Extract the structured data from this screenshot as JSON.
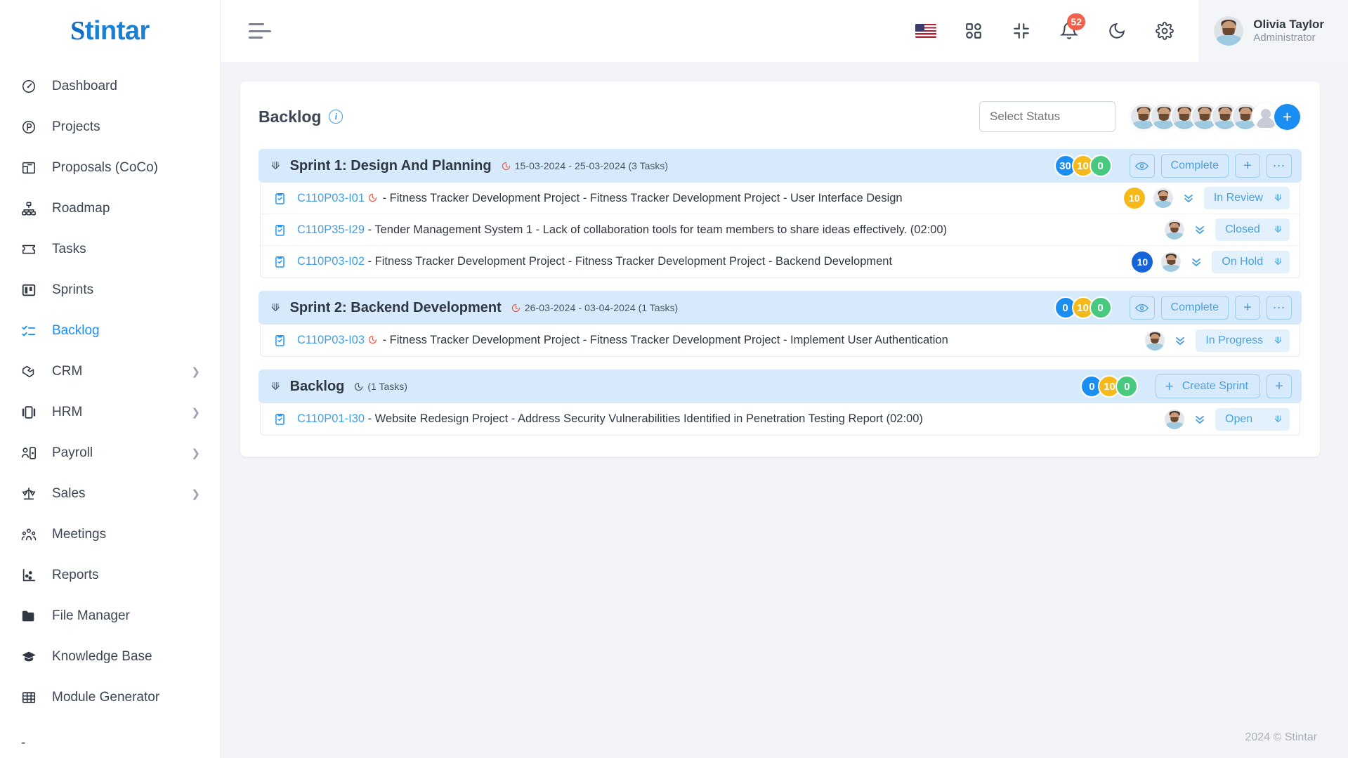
{
  "brand": {
    "logo_text": "Stintar",
    "logo_mark": "S"
  },
  "sidebar": {
    "items": [
      {
        "label": "Dashboard",
        "icon": "gauge-icon",
        "active": false,
        "has_chevron": false
      },
      {
        "label": "Projects",
        "icon": "projects-circle-p-icon",
        "active": false,
        "has_chevron": false
      },
      {
        "label": "Proposals (CoCo)",
        "icon": "proposals-icon",
        "active": false,
        "has_chevron": false
      },
      {
        "label": "Roadmap",
        "icon": "roadmap-hierarchy-icon",
        "active": false,
        "has_chevron": false
      },
      {
        "label": "Tasks",
        "icon": "ticket-icon",
        "active": false,
        "has_chevron": false
      },
      {
        "label": "Sprints",
        "icon": "board-icon",
        "active": false,
        "has_chevron": false
      },
      {
        "label": "Backlog",
        "icon": "checklist-icon",
        "active": true,
        "has_chevron": false
      },
      {
        "label": "CRM",
        "icon": "handshake-icon",
        "active": false,
        "has_chevron": true
      },
      {
        "label": "HRM",
        "icon": "hrm-icon",
        "active": false,
        "has_chevron": true
      },
      {
        "label": "Payroll",
        "icon": "payroll-person-icon",
        "active": false,
        "has_chevron": true
      },
      {
        "label": "Sales",
        "icon": "scales-icon",
        "active": false,
        "has_chevron": true
      },
      {
        "label": "Meetings",
        "icon": "people-group-icon",
        "active": false,
        "has_chevron": false
      },
      {
        "label": "Reports",
        "icon": "reports-chart-icon",
        "active": false,
        "has_chevron": false
      },
      {
        "label": "File Manager",
        "icon": "folder-icon",
        "active": false,
        "has_chevron": false
      },
      {
        "label": "Knowledge Base",
        "icon": "graduation-cap-icon",
        "active": false,
        "has_chevron": false
      },
      {
        "label": "Module Generator",
        "icon": "grid-table-icon",
        "active": false,
        "has_chevron": false
      }
    ],
    "trailing_mark": "-"
  },
  "topbar": {
    "menu_toggle": "hamburger-icon",
    "language_flag": "us-flag-icon",
    "apps_icon": "apps-grid-icon",
    "fullscreen_icon": "collapse-screen-icon",
    "notifications_icon": "bell-icon",
    "notifications_count": "52",
    "theme_icon": "moon-icon",
    "settings_icon": "gear-icon",
    "user": {
      "name": "Olivia Taylor",
      "role": "Administrator"
    }
  },
  "panel": {
    "title": "Backlog",
    "info_tooltip_icon": "info-icon",
    "status_filter_placeholder": "Select Status",
    "member_avatar_count": 6,
    "add_member_label": "+"
  },
  "groups": [
    {
      "name": "Sprint 1: Design And Planning",
      "dates": "15-03-2024 - 25-03-2024",
      "task_count_label": "(3 Tasks)",
      "clock_color": "#f05a4f",
      "pills": [
        {
          "value": "30",
          "color": "blue"
        },
        {
          "value": "10",
          "color": "amber"
        },
        {
          "value": "0",
          "color": "green"
        }
      ],
      "buttons": [
        {
          "label": "",
          "icon": "eye-icon",
          "name": "preview-sprint-button"
        },
        {
          "label": "Complete",
          "icon": "",
          "name": "complete-sprint-button"
        },
        {
          "label": "",
          "icon": "plus-icon",
          "name": "add-task-button"
        },
        {
          "label": "",
          "icon": "ellipsis-icon",
          "name": "sprint-more-button"
        }
      ],
      "tasks": [
        {
          "key": "C110P03-I01",
          "has_clock": true,
          "text": " - Fitness Tracker Development Project - Fitness Tracker Development Project - User Interface Design",
          "estimate": "10",
          "estimate_color": "amber",
          "status": "In Review"
        },
        {
          "key": "C110P35-I29",
          "has_clock": false,
          "text": " - Tender Management System 1 - Lack of collaboration tools for team members to share ideas effectively. (02:00)",
          "estimate": "",
          "estimate_color": "",
          "status": "Closed"
        },
        {
          "key": "C110P03-I02",
          "has_clock": false,
          "text": " - Fitness Tracker Development Project - Fitness Tracker Development Project - Backend Development",
          "estimate": "10",
          "estimate_color": "blue",
          "status": "On Hold"
        }
      ]
    },
    {
      "name": "Sprint 2: Backend Development",
      "dates": "26-03-2024 - 03-04-2024",
      "task_count_label": "(1 Tasks)",
      "clock_color": "#f05a4f",
      "pills": [
        {
          "value": "0",
          "color": "blue"
        },
        {
          "value": "10",
          "color": "amber"
        },
        {
          "value": "0",
          "color": "green"
        }
      ],
      "buttons": [
        {
          "label": "",
          "icon": "eye-icon",
          "name": "preview-sprint-button"
        },
        {
          "label": "Complete",
          "icon": "",
          "name": "complete-sprint-button"
        },
        {
          "label": "",
          "icon": "plus-icon",
          "name": "add-task-button"
        },
        {
          "label": "",
          "icon": "ellipsis-icon",
          "name": "sprint-more-button"
        }
      ],
      "tasks": [
        {
          "key": "C110P03-I03",
          "has_clock": true,
          "text": " - Fitness Tracker Development Project - Fitness Tracker Development Project - Implement User Authentication",
          "estimate": "",
          "estimate_color": "",
          "status": "In Progress"
        }
      ]
    },
    {
      "name": "Backlog",
      "dates": "",
      "task_count_label": "(1 Tasks)",
      "clock_color": "#4b5563",
      "pills": [
        {
          "value": "0",
          "color": "blue"
        },
        {
          "value": "10",
          "color": "amber"
        },
        {
          "value": "0",
          "color": "green"
        }
      ],
      "buttons": [
        {
          "label": "Create Sprint",
          "icon": "plus-icon",
          "name": "create-sprint-button"
        },
        {
          "label": "",
          "icon": "plus-icon",
          "name": "add-task-button"
        }
      ],
      "tasks": [
        {
          "key": "C110P01-I30",
          "has_clock": false,
          "text": " - Website Redesign Project - Address Security Vulnerabilities Identified in Penetration Testing Report (02:00)",
          "estimate": "",
          "estimate_color": "",
          "status": "Open"
        }
      ]
    }
  ],
  "footer": {
    "copyright": "2024 © Stintar"
  },
  "colors": {
    "accent": "#1b8ef2",
    "group_header_bg": "#d6eafb",
    "badge_red": "#f2614b",
    "pill_blue": "#1b8ef2",
    "pill_amber": "#f5b91a",
    "pill_green": "#49c97f"
  }
}
